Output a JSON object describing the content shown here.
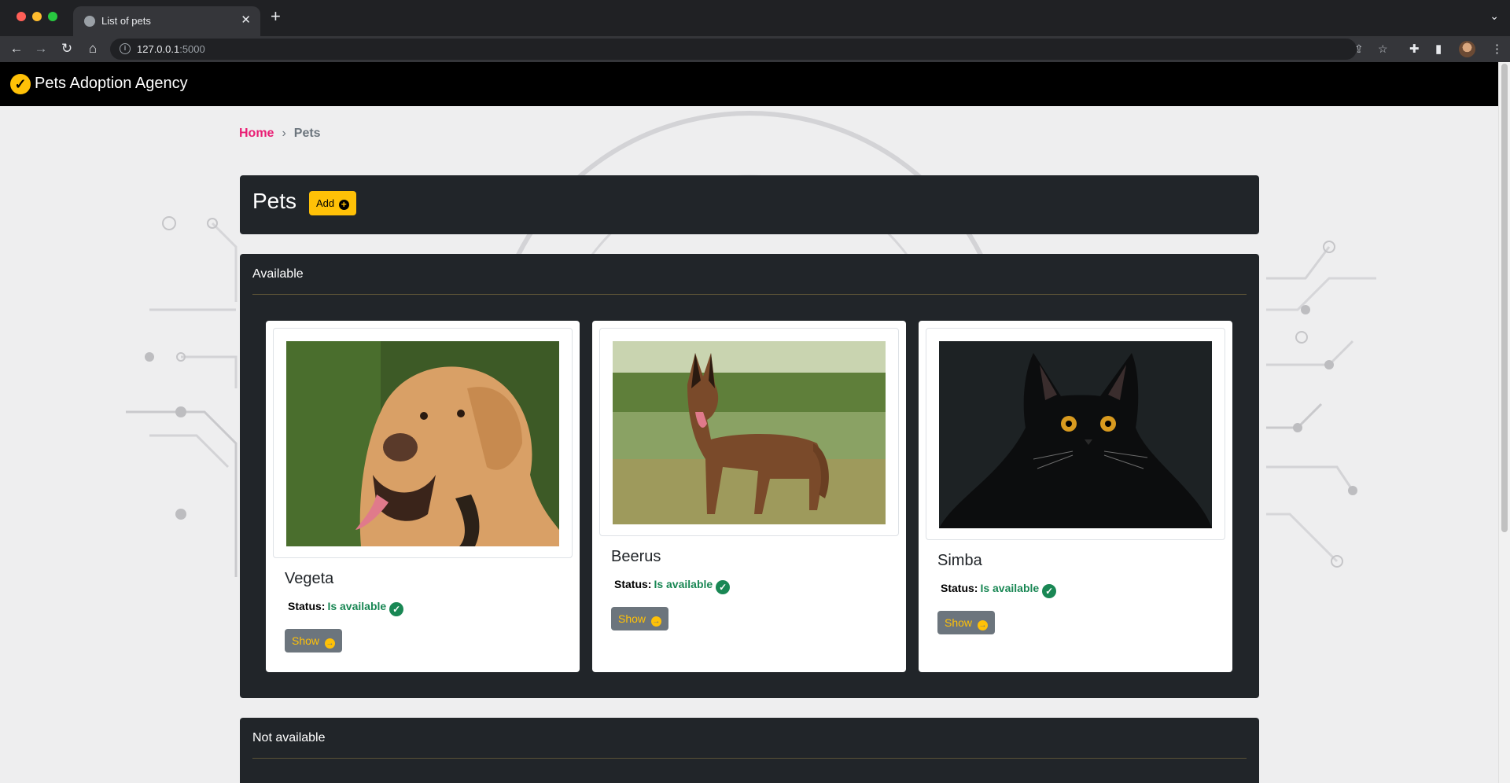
{
  "browser": {
    "tab_title": "List of pets",
    "url_host": "127.0.0.1",
    "url_port": ":5000"
  },
  "navbar": {
    "brand": "Pets Adoption Agency"
  },
  "breadcrumb": {
    "home": "Home",
    "separator": "›",
    "current": "Pets"
  },
  "header": {
    "title": "Pets",
    "add_label": "Add"
  },
  "available": {
    "title": "Available",
    "pets": [
      {
        "name": "Vegeta",
        "status_label": "Status:",
        "status": "Is available",
        "show_label": "Show",
        "photo": "golden-retriever-photo"
      },
      {
        "name": "Beerus",
        "status_label": "Status:",
        "status": "Is available",
        "show_label": "Show",
        "photo": "malinois-photo"
      },
      {
        "name": "Simba",
        "status_label": "Status:",
        "status": "Is available",
        "show_label": "Show",
        "photo": "black-cat-photo"
      }
    ]
  },
  "not_available": {
    "title": "Not available"
  },
  "colors": {
    "accent": "#ffc107",
    "link": "#e91e74",
    "status_ok": "#198754",
    "panel": "#212529"
  }
}
